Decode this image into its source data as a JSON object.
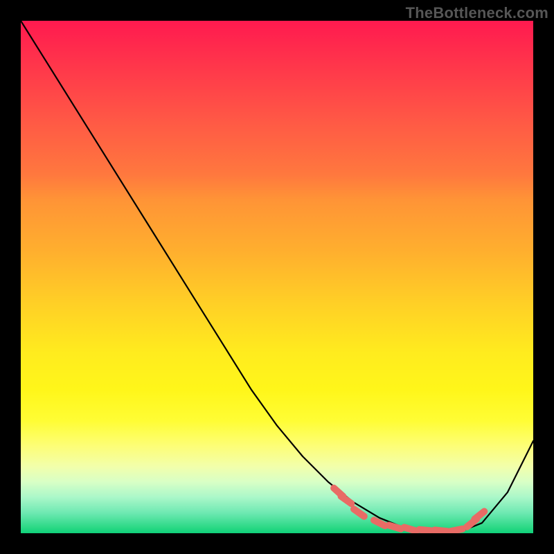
{
  "watermark": "TheBottleneck.com",
  "colors": {
    "frame": "#000000",
    "curve": "#000000",
    "dashes": "#e86b65"
  },
  "chart_data": {
    "type": "line",
    "title": "",
    "xlabel": "",
    "ylabel": "",
    "xlim": [
      0,
      100
    ],
    "ylim": [
      0,
      100
    ],
    "grid": false,
    "series": [
      {
        "name": "curve",
        "x": [
          0,
          5,
          10,
          15,
          20,
          25,
          30,
          35,
          40,
          45,
          50,
          55,
          60,
          65,
          70,
          75,
          80,
          85,
          90,
          95,
          100
        ],
        "y": [
          100,
          92,
          84,
          76,
          68,
          60,
          52,
          44,
          36,
          28,
          21,
          15,
          10,
          6,
          3,
          1,
          0,
          0,
          2,
          8,
          18
        ]
      }
    ],
    "highlight_dashes": [
      {
        "x": 62,
        "y": 8
      },
      {
        "x": 63.5,
        "y": 6.5
      },
      {
        "x": 66,
        "y": 4
      },
      {
        "x": 70,
        "y": 2
      },
      {
        "x": 73,
        "y": 1.2
      },
      {
        "x": 76,
        "y": 0.8
      },
      {
        "x": 79,
        "y": 0.6
      },
      {
        "x": 82,
        "y": 0.5
      },
      {
        "x": 85,
        "y": 0.6
      },
      {
        "x": 88,
        "y": 2
      },
      {
        "x": 89.5,
        "y": 3.5
      }
    ],
    "gradient_stops": [
      {
        "pos": 0,
        "color": "#ff1a4f"
      },
      {
        "pos": 50,
        "color": "#ffcf26"
      },
      {
        "pos": 80,
        "color": "#fffd34"
      },
      {
        "pos": 100,
        "color": "#0fd07a"
      }
    ],
    "notes": "y-values are estimated from the plotted curve against the vertical extent of the gradient area (0 = bottom/green, 100 = top/red). The curve descends roughly linearly from top-left, flattens to a minimum near x≈80–85, then rises toward the right edge. Salmon dashes mark the trough region."
  }
}
